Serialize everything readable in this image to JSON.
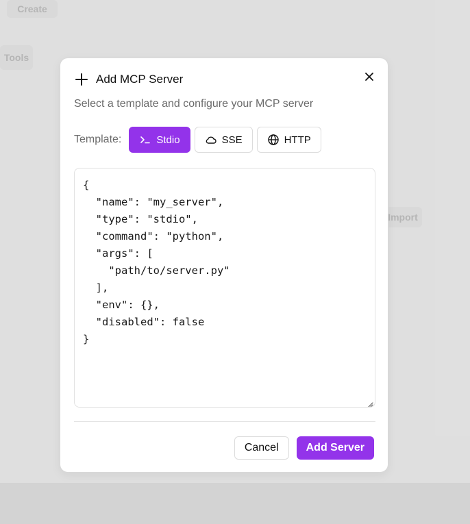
{
  "background": {
    "top_button": "Create",
    "side_label": "Tools",
    "row_button": "Import"
  },
  "dialog": {
    "title": "Add MCP Server",
    "description": "Select a template and configure your MCP server",
    "template_label": "Template:",
    "templates": [
      {
        "label": "Stdio",
        "icon": "terminal-icon",
        "active": true
      },
      {
        "label": "SSE",
        "icon": "cloud-icon",
        "active": false
      },
      {
        "label": "HTTP",
        "icon": "globe-icon",
        "active": false
      }
    ],
    "config_text": "{\n  \"name\": \"my_server\",\n  \"type\": \"stdio\",\n  \"command\": \"python\",\n  \"args\": [\n    \"path/to/server.py\"\n  ],\n  \"env\": {},\n  \"disabled\": false\n}",
    "cancel_label": "Cancel",
    "submit_label": "Add Server"
  },
  "colors": {
    "accent": "#9333ea",
    "text": "#111111",
    "muted": "#6b6b6b"
  }
}
